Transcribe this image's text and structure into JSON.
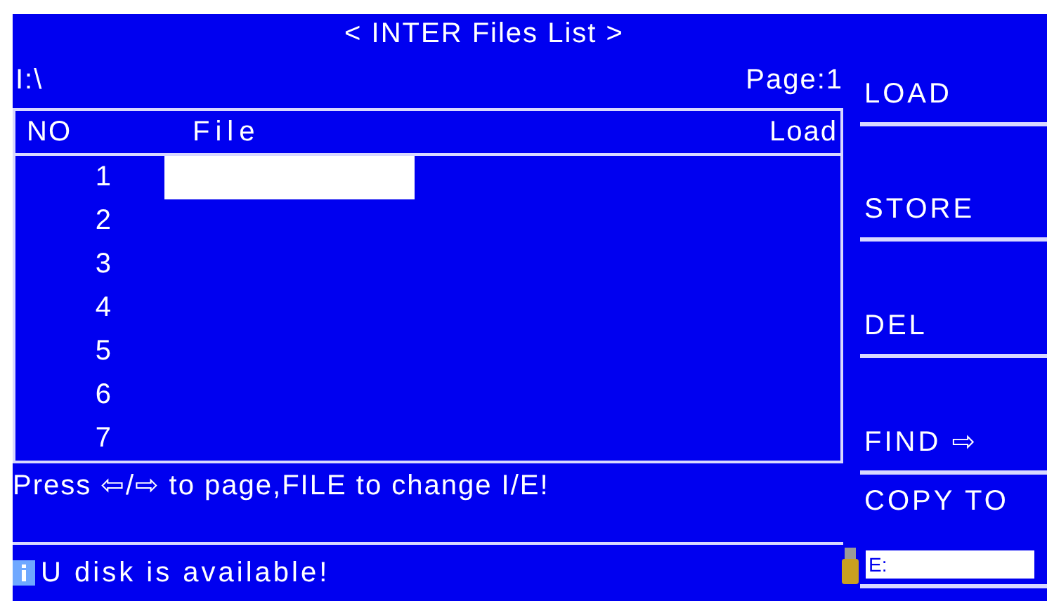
{
  "title": "< INTER Files List >",
  "path": "I:\\",
  "page": "Page:1",
  "table": {
    "columns": [
      "NO",
      "File",
      "Load"
    ],
    "rows": [
      {
        "no": "1",
        "selected": true
      },
      {
        "no": "2",
        "selected": false
      },
      {
        "no": "3",
        "selected": false
      },
      {
        "no": "4",
        "selected": false
      },
      {
        "no": "5",
        "selected": false
      },
      {
        "no": "6",
        "selected": false
      },
      {
        "no": "7",
        "selected": false
      }
    ]
  },
  "hint": "Press ⇦/⇨ to page,FILE to change I/E!",
  "status": {
    "message": "U disk is available!"
  },
  "softkeys": [
    {
      "kind": "button",
      "label": "LOAD"
    },
    {
      "kind": "button",
      "label": "STORE"
    },
    {
      "kind": "button",
      "label": "DEL"
    },
    {
      "kind": "button",
      "label": "FIND ⇨"
    },
    {
      "kind": "input",
      "label": "COPY TO",
      "value": "E:"
    }
  ]
}
